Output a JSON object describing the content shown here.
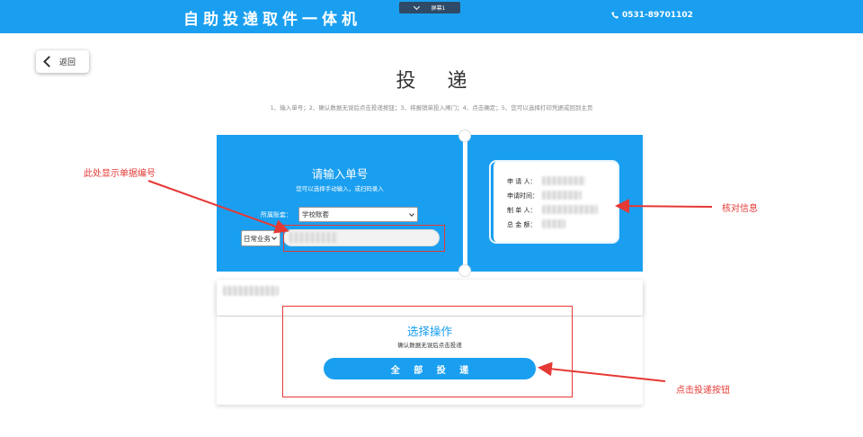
{
  "header": {
    "app_title": "自助投递取件一体机",
    "screen_switch_label": "屏幕1",
    "phone": "0531-89701102",
    "bg_color": "#1a9ff0"
  },
  "back_button": {
    "label": "返回",
    "icon": "chevron-left-icon"
  },
  "page": {
    "title": "投 递",
    "steps": "1、输入单号；2、确认数据无误后点击投递按钮；3、将报销单投入闸门；4、点击确定；5、您可以选择打印凭据或回到主页"
  },
  "input_panel": {
    "title": "请输入单号",
    "subtitle": "您可以选择手动输入，或扫码录入",
    "account_label": "所属账套：",
    "account_value": "学校账套",
    "business_value": "日常业务"
  },
  "verify_panel": {
    "rows": [
      {
        "label": "申 请 人："
      },
      {
        "label": "申请时间："
      },
      {
        "label": "制 单 人："
      },
      {
        "label": "总 金 额："
      }
    ]
  },
  "operation": {
    "title": "选择操作",
    "subtitle": "确认数据无误后点击投递",
    "deliver_button": "全 部 投 递"
  },
  "annotations": {
    "order_number_note": "此处显示单据编号",
    "verify_note": "核对信息",
    "click_note": "点击投递按钮",
    "color": "#e53935"
  }
}
